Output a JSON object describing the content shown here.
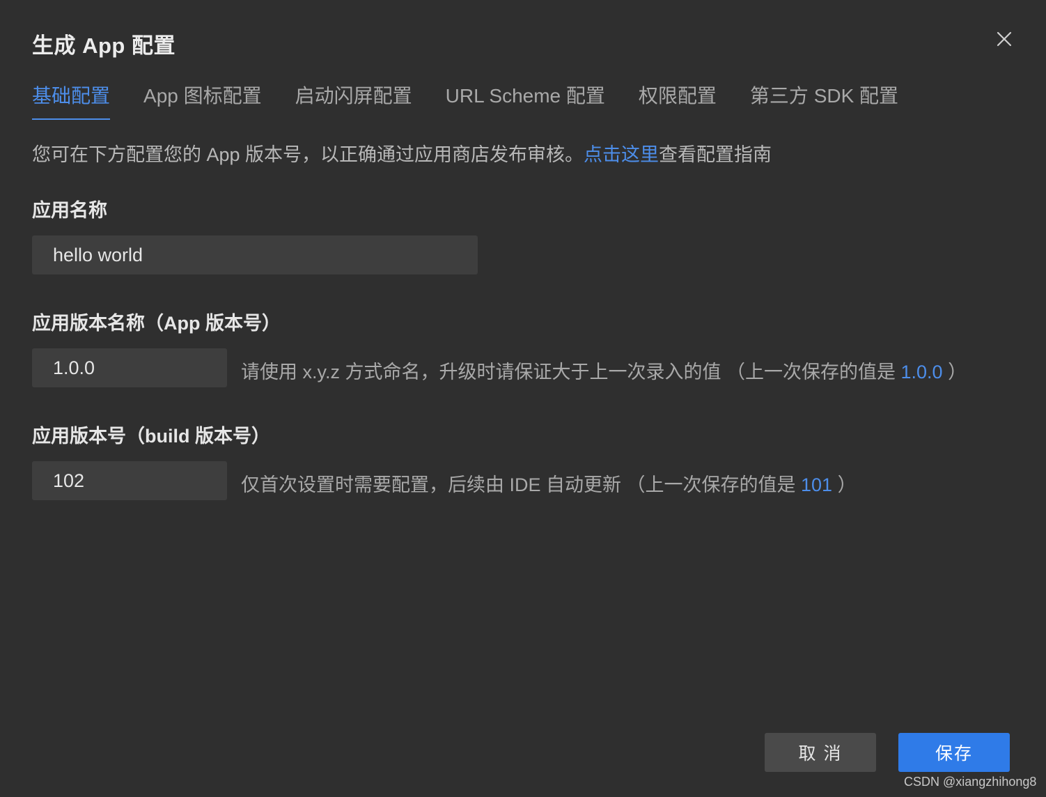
{
  "dialog": {
    "title": "生成 App 配置",
    "close_icon": "close-icon"
  },
  "tabs": [
    {
      "label": "基础配置",
      "active": true
    },
    {
      "label": "App 图标配置",
      "active": false
    },
    {
      "label": "启动闪屏配置",
      "active": false
    },
    {
      "label": "URL Scheme 配置",
      "active": false
    },
    {
      "label": "权限配置",
      "active": false
    },
    {
      "label": "第三方 SDK 配置",
      "active": false
    }
  ],
  "intro": {
    "text_before": "您可在下方配置您的 App 版本号，以正确通过应用商店发布审核。",
    "link": "点击这里",
    "text_after": "查看配置指南"
  },
  "fields": {
    "app_name": {
      "label": "应用名称",
      "value": "hello world"
    },
    "version_name": {
      "label": "应用版本名称（App 版本号）",
      "value": "1.0.0",
      "hint_before": "请使用 x.y.z 方式命名，升级时请保证大于上一次录入的值 （上一次保存的值是 ",
      "hint_value": "1.0.0",
      "hint_after": " ）"
    },
    "build_number": {
      "label": "应用版本号（build 版本号）",
      "value": "102",
      "hint_before": "仅首次设置时需要配置，后续由 IDE 自动更新 （上一次保存的值是 ",
      "hint_value": "101",
      "hint_after": " ）"
    }
  },
  "buttons": {
    "cancel": "取 消",
    "save": "保存"
  },
  "watermark": "CSDN @xiangzhihong8",
  "colors": {
    "accent": "#4d8eea",
    "primary_button": "#2f7be8",
    "background": "#2f2f2f",
    "input_bg": "#3e3e3e"
  }
}
